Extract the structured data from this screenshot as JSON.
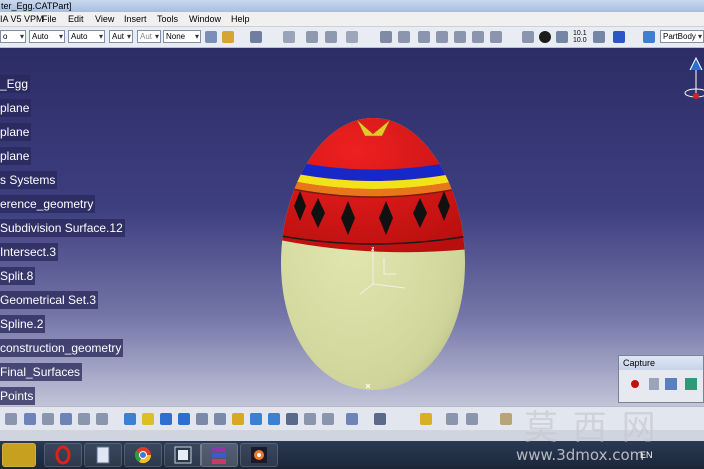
{
  "window": {
    "title": "ter_Egg.CATPart]"
  },
  "menu": {
    "items": [
      "IA V5 VPM",
      "File",
      "Edit",
      "View",
      "Insert",
      "Tools",
      "Window",
      "Help"
    ]
  },
  "toolbar": {
    "combos": [
      "o",
      "Auto",
      "Auto",
      "Aut",
      "Aut",
      "None"
    ],
    "part_body": "PartBody",
    "ratio_top": "10.1",
    "ratio_bottom": "10.0"
  },
  "tree": {
    "items": [
      "_Egg",
      "plane",
      "plane",
      "plane",
      "s Systems",
      "erence_geometry",
      "Subdivision Surface.12",
      "Intersect.3",
      "Split.8",
      "Geometrical Set.3",
      "Spline.2",
      "construction_geometry",
      "Final_Surfaces",
      "Points"
    ]
  },
  "capture": {
    "title": "Capture"
  },
  "statusbar": {
    "language": "EN"
  },
  "watermark": {
    "chars": "莫 西 网",
    "url": "www.3dmox.com"
  },
  "colors": {
    "egg_base": "#d8dea6",
    "egg_band": "#d81818",
    "stripe_blue": "#1628c8",
    "stripe_yellow": "#f2e21a",
    "stripe_orange": "#e8761a",
    "diamond": "#111111"
  }
}
